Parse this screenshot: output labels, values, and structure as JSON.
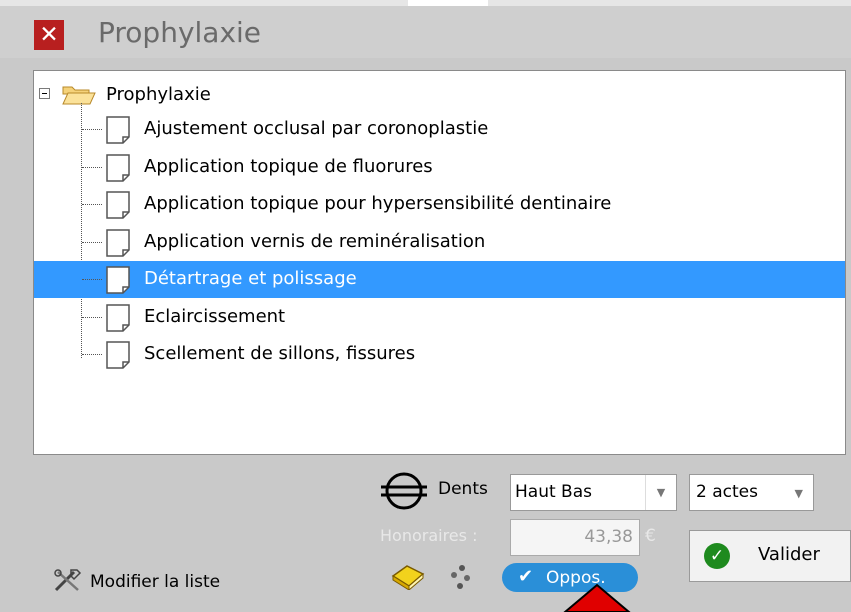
{
  "window": {
    "title": "Prophylaxie",
    "close_glyph": "✕"
  },
  "tree": {
    "root": {
      "label": "Prophylaxie",
      "icon": "folder-open-icon",
      "expanded": true
    },
    "items": [
      {
        "label": "Ajustement occlusal par coronoplastie",
        "selected": false
      },
      {
        "label": "Application topique de fluorures",
        "selected": false
      },
      {
        "label": "Application topique pour hypersensibilité dentinaire",
        "selected": false
      },
      {
        "label": "Application vernis de reminéralisation",
        "selected": false
      },
      {
        "label": "Détartrage et polissage",
        "selected": true
      },
      {
        "label": "Eclaircissement",
        "selected": false
      },
      {
        "label": "Scellement de sillons, fissures",
        "selected": false
      }
    ]
  },
  "controls": {
    "dents_label": "Dents",
    "dents_value": "Haut Bas",
    "actes_value": "2 actes",
    "honoraires_label": "Honoraires :",
    "honoraires_value": "43,38",
    "currency": "€",
    "valider_label": "Valider",
    "modifier_label": "Modifier la liste",
    "oppos_label": "Oppos.",
    "oppos_check": "✔"
  },
  "colors": {
    "selection": "#3399ff",
    "close": "#b81f1f",
    "valider_check": "#1e8a1e",
    "oppos_pill": "#2a8fd8",
    "arrow": "#e00000"
  }
}
